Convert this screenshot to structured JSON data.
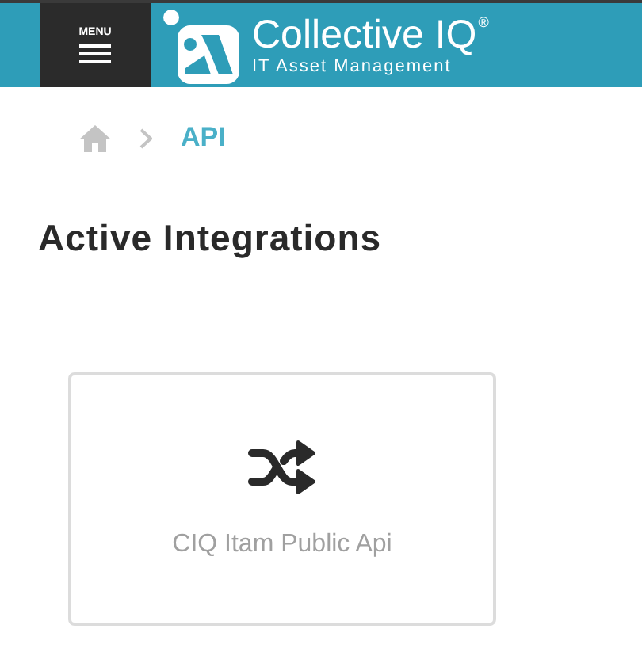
{
  "header": {
    "menu_label": "MENU",
    "brand_name": "Collective IQ",
    "brand_mark": "®",
    "brand_tagline": "IT Asset Management"
  },
  "breadcrumb": {
    "current": "API"
  },
  "page_title": "Active Integrations",
  "integrations": [
    {
      "name": "CIQ Itam Public Api"
    }
  ]
}
